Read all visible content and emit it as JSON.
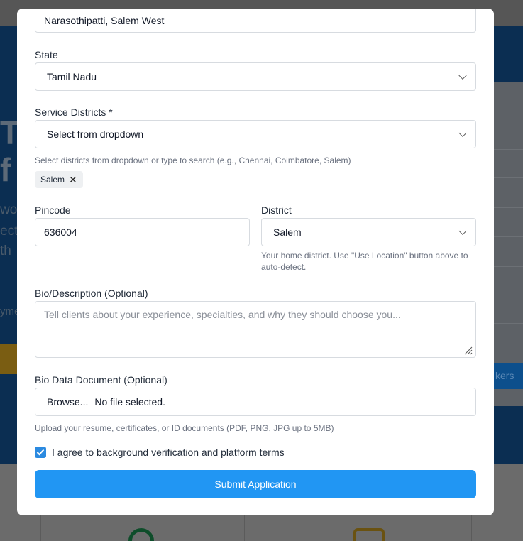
{
  "background": {
    "hero_lines": [
      "T",
      "f",
      "wor",
      "ect",
      "th",
      "yme"
    ],
    "side_button_label": "kers"
  },
  "form": {
    "address_value": "Narasothipatti, Salem West",
    "state": {
      "label": "State",
      "value": "Tamil Nadu"
    },
    "service_districts": {
      "label": "Service Districts *",
      "placeholder": "Select from dropdown",
      "hint": "Select districts from dropdown or type to search (e.g., Chennai, Coimbatore, Salem)",
      "selected": [
        "Salem"
      ],
      "remove_glyph": "✕"
    },
    "pincode": {
      "label": "Pincode",
      "value": "636004"
    },
    "district": {
      "label": "District",
      "value": "Salem",
      "hint": "Your home district. Use \"Use Location\" button above to auto-detect."
    },
    "bio": {
      "label": "Bio/Description (Optional)",
      "placeholder": "Tell clients about your experience, specialties, and why they should choose you..."
    },
    "bio_document": {
      "label": "Bio Data Document (Optional)",
      "browse_label": "Browse...",
      "status": "No file selected.",
      "hint": "Upload your resume, certificates, or ID documents (PDF, PNG, JPG up to 5MB)"
    },
    "agreement": {
      "label": "I agree to background verification and platform terms",
      "checked": true
    },
    "submit_label": "Submit Application"
  },
  "colors": {
    "accent": "#2196f3",
    "checkbox": "#2b8ae0",
    "overlay": "#6b6b6b"
  }
}
